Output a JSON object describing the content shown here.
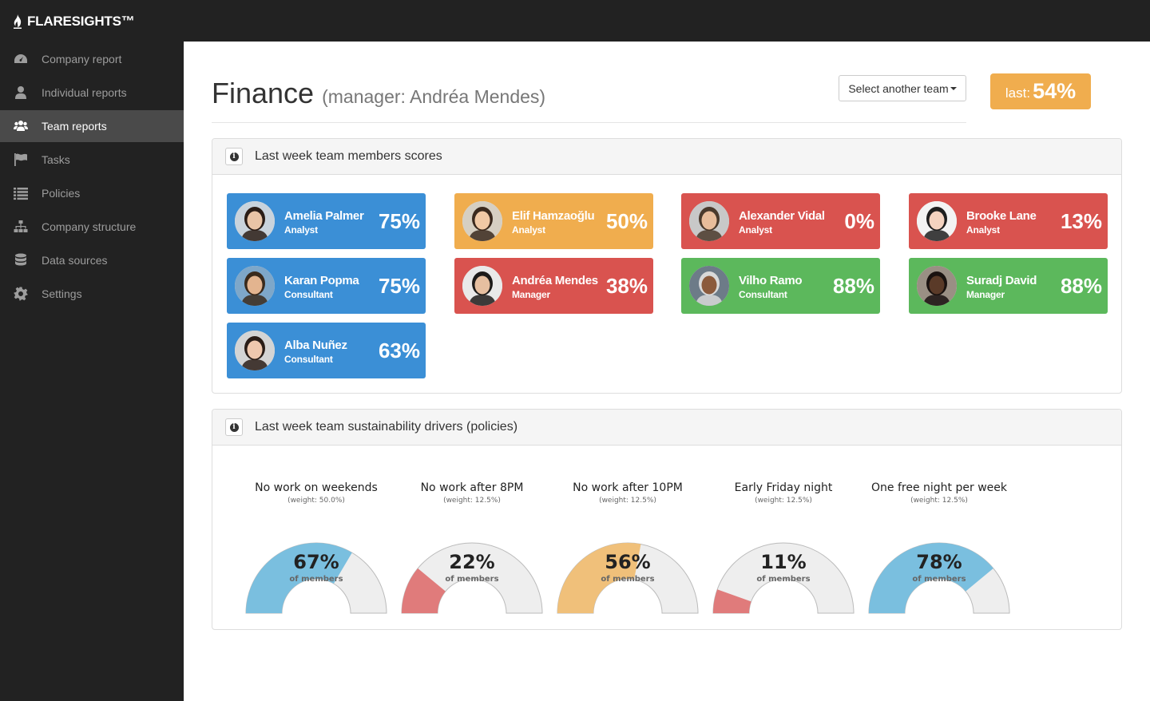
{
  "brand": {
    "name": "FLARESIGHTS™"
  },
  "sidebar": {
    "items": [
      {
        "label": "Company report",
        "icon": "dashboard-icon"
      },
      {
        "label": "Individual reports",
        "icon": "user-icon"
      },
      {
        "label": "Team reports",
        "icon": "users-icon",
        "active": true
      },
      {
        "label": "Tasks",
        "icon": "flag-icon"
      },
      {
        "label": "Policies",
        "icon": "list-icon"
      },
      {
        "label": "Company structure",
        "icon": "sitemap-icon"
      },
      {
        "label": "Data sources",
        "icon": "database-icon"
      },
      {
        "label": "Settings",
        "icon": "gear-icon"
      }
    ]
  },
  "header": {
    "team": "Finance",
    "manager": "(manager: Andréa Mendes)",
    "select_label": "Select another team",
    "last_label": "last:",
    "last_value": "54%"
  },
  "colors": {
    "blue": "#3b8fd6",
    "orange": "#f0ad4e",
    "red": "#d9534f",
    "green": "#5cb85c",
    "gauge_blue": "#7abfdf",
    "gauge_orange": "#f0c07a",
    "gauge_red": "#e07b7b",
    "gauge_bg": "#eeeeee"
  },
  "members_panel": {
    "title": "Last week team members scores",
    "members": [
      {
        "name": "Amelia Palmer",
        "role": "Analyst",
        "score": "75%",
        "color": "#3b8fd6"
      },
      {
        "name": "Elif Hamzaoğlu",
        "role": "Analyst",
        "score": "50%",
        "color": "#f0ad4e"
      },
      {
        "name": "Alexander Vidal",
        "role": "Analyst",
        "score": "0%",
        "color": "#d9534f"
      },
      {
        "name": "Brooke Lane",
        "role": "Analyst",
        "score": "13%",
        "color": "#d9534f"
      },
      {
        "name": "Karan Popma",
        "role": "Consultant",
        "score": "75%",
        "color": "#3b8fd6"
      },
      {
        "name": "Andréa Mendes",
        "role": "Manager",
        "score": "38%",
        "color": "#d9534f"
      },
      {
        "name": "Vilho Ramo",
        "role": "Consultant",
        "score": "88%",
        "color": "#5cb85c"
      },
      {
        "name": "Suradj David",
        "role": "Manager",
        "score": "88%",
        "color": "#5cb85c"
      },
      {
        "name": "Alba Nuñez",
        "role": "Consultant",
        "score": "63%",
        "color": "#3b8fd6"
      }
    ]
  },
  "drivers_panel": {
    "title": "Last week team sustainability drivers (policies)",
    "gauges": [
      {
        "title": "No work on weekends",
        "weight": "(weight: 50.0%)",
        "value": "67%",
        "fraction": 0.67,
        "unit": "of members",
        "color": "#7abfdf"
      },
      {
        "title": "No work after 8PM",
        "weight": "(weight: 12.5%)",
        "value": "22%",
        "fraction": 0.22,
        "unit": "of members",
        "color": "#e07b7b"
      },
      {
        "title": "No work after 10PM",
        "weight": "(weight: 12.5%)",
        "value": "56%",
        "fraction": 0.56,
        "unit": "of members",
        "color": "#f0c07a"
      },
      {
        "title": "Early Friday night",
        "weight": "(weight: 12.5%)",
        "value": "11%",
        "fraction": 0.11,
        "unit": "of members",
        "color": "#e07b7b"
      },
      {
        "title": "One free night per week",
        "weight": "(weight: 12.5%)",
        "value": "78%",
        "fraction": 0.78,
        "unit": "of members",
        "color": "#7abfdf"
      }
    ]
  }
}
